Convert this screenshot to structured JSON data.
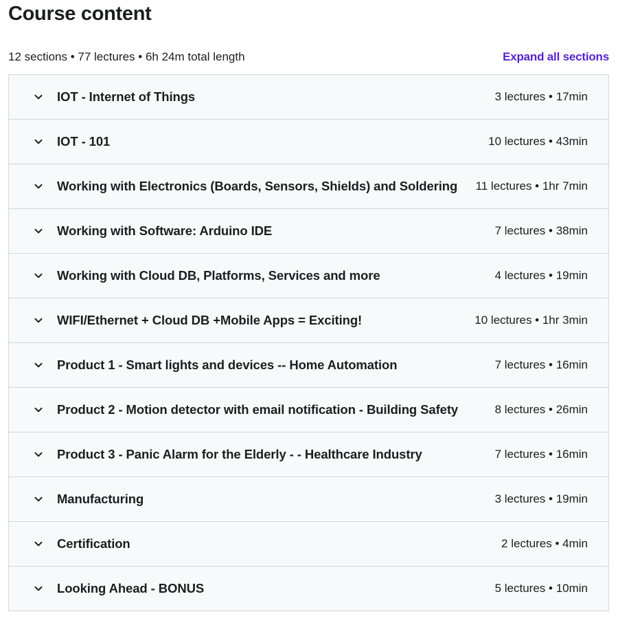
{
  "header": {
    "title": "Course content",
    "summary": "12 sections • 77 lectures • 6h 24m total length",
    "expand_label": "Expand all sections"
  },
  "sections": [
    {
      "title": "IOT - Internet of Things",
      "meta": "3 lectures • 17min",
      "expanded": false
    },
    {
      "title": "IOT - 101",
      "meta": "10 lectures • 43min",
      "expanded": false
    },
    {
      "title": "Working with Electronics (Boards, Sensors, Shields) and Soldering",
      "meta": "11 lectures • 1hr 7min",
      "expanded": false
    },
    {
      "title": "Working with Software: Arduino IDE",
      "meta": "7 lectures • 38min",
      "expanded": false
    },
    {
      "title": "Working with Cloud DB, Platforms, Services and more",
      "meta": "4 lectures • 19min",
      "expanded": false
    },
    {
      "title": "WIFI/Ethernet + Cloud DB +Mobile Apps = Exciting!",
      "meta": "10 lectures • 1hr 3min",
      "expanded": false
    },
    {
      "title": "Product 1 - Smart lights and devices -- Home Automation",
      "meta": "7 lectures • 16min",
      "expanded": false
    },
    {
      "title": "Product 2 - Motion detector with email notification - Building Safety",
      "meta": "8 lectures • 26min",
      "expanded": false
    },
    {
      "title": "Product 3 - Panic Alarm for the Elderly - - Healthcare Industry",
      "meta": "7 lectures • 16min",
      "expanded": false
    },
    {
      "title": "Manufacturing",
      "meta": "3 lectures • 19min",
      "expanded": false
    },
    {
      "title": "Certification",
      "meta": "2 lectures • 4min",
      "expanded": false
    },
    {
      "title": "Looking Ahead - BONUS",
      "meta": "5 lectures • 10min",
      "expanded": false
    }
  ],
  "icons": {
    "section_toggle": "chevron-down-icon"
  },
  "colors": {
    "text": "#1c1d1f",
    "link": "#5624d0",
    "section_bg": "#f7f9fa",
    "border": "#d1d7dc"
  }
}
